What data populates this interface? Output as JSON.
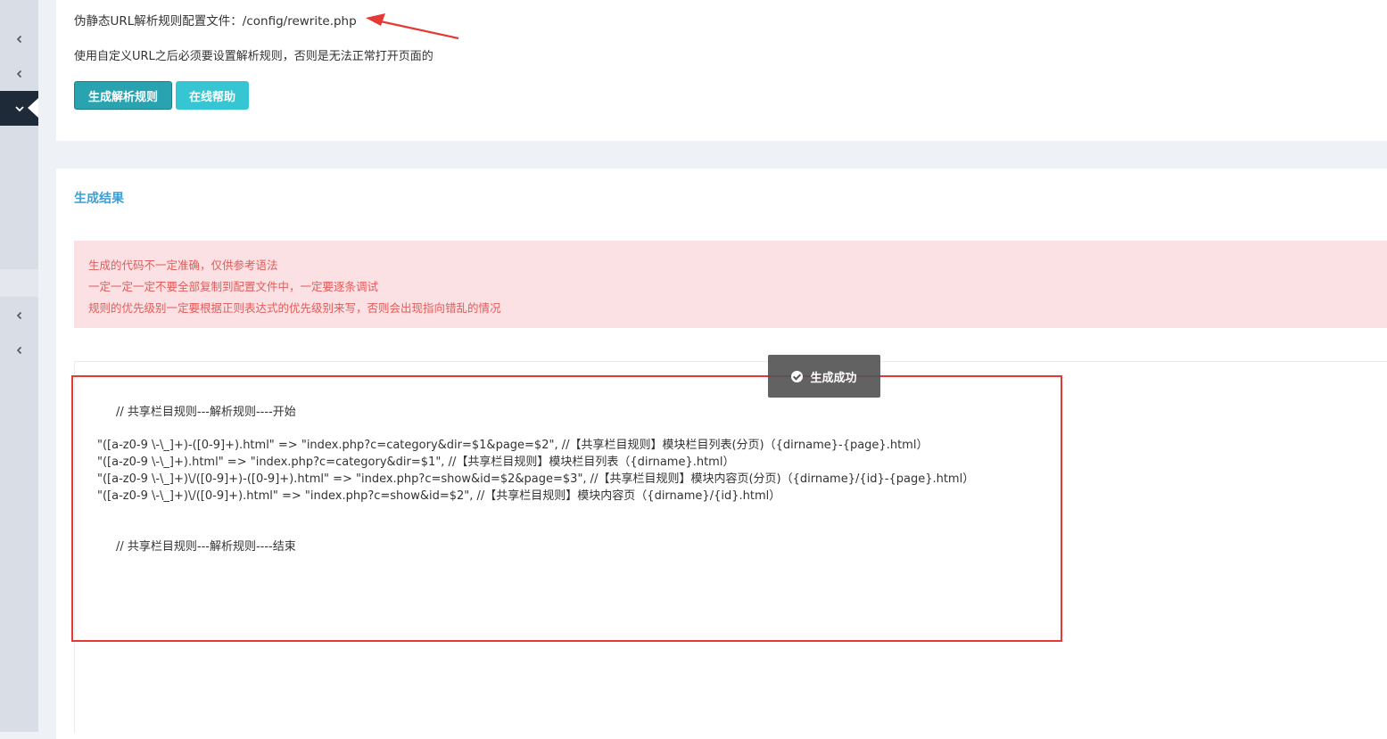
{
  "sidebar": {
    "items": [
      {
        "icon": "chevron-left-icon"
      },
      {
        "icon": "chevron-left-icon"
      },
      {
        "icon": "chevron-down-icon",
        "active": true
      },
      {
        "icon": "chevron-left-icon"
      },
      {
        "icon": "chevron-left-icon"
      }
    ]
  },
  "config": {
    "file_line": "伪静态URL解析规则配置文件：/config/rewrite.php",
    "note": "使用自定义URL之后必须要设置解析规则，否则是无法正常打开页面的"
  },
  "buttons": {
    "generate_label": "生成解析规则",
    "help_label": "在线帮助"
  },
  "result": {
    "title": "生成结果",
    "alerts": [
      "生成的代码不一定准确，仅供参考语法",
      "一定一定一定不要全部复制到配置文件中，一定要逐条调试",
      "规则的优先级别一定要根据正则表达式的优先级别来写，否则会出现指向错乱的情况"
    ],
    "code_lines": [
      "// 共享栏目规则---解析规则----开始",
      "\"([a-z0-9 \\-\\_]+)-([0-9]+).html\" => \"index.php?c=category&dir=$1&page=$2\", //【共享栏目规则】模块栏目列表(分页)（{dirname}-{page}.html）",
      "\"([a-z0-9 \\-\\_]+).html\" => \"index.php?c=category&dir=$1\", //【共享栏目规则】模块栏目列表（{dirname}.html）",
      "\"([a-z0-9 \\-\\_]+)\\/([0-9]+)-([0-9]+).html\" => \"index.php?c=show&id=$2&page=$3\", //【共享栏目规则】模块内容页(分页)（{dirname}/{id}-{page}.html）",
      "\"([a-z0-9 \\-\\_]+)\\/([0-9]+).html\" => \"index.php?c=show&id=$2\", //【共享栏目规则】模块内容页（{dirname}/{id}.html）",
      "// 共享栏目规则---解析规则----结束"
    ]
  },
  "toast": {
    "message": "生成成功"
  },
  "colors": {
    "primary": "#2aa3b0",
    "info": "#36c6d3",
    "danger_text": "#e35b5a",
    "danger_bg": "#fbe1e3",
    "title": "#3c9fd8",
    "annotation": "#e53935"
  }
}
